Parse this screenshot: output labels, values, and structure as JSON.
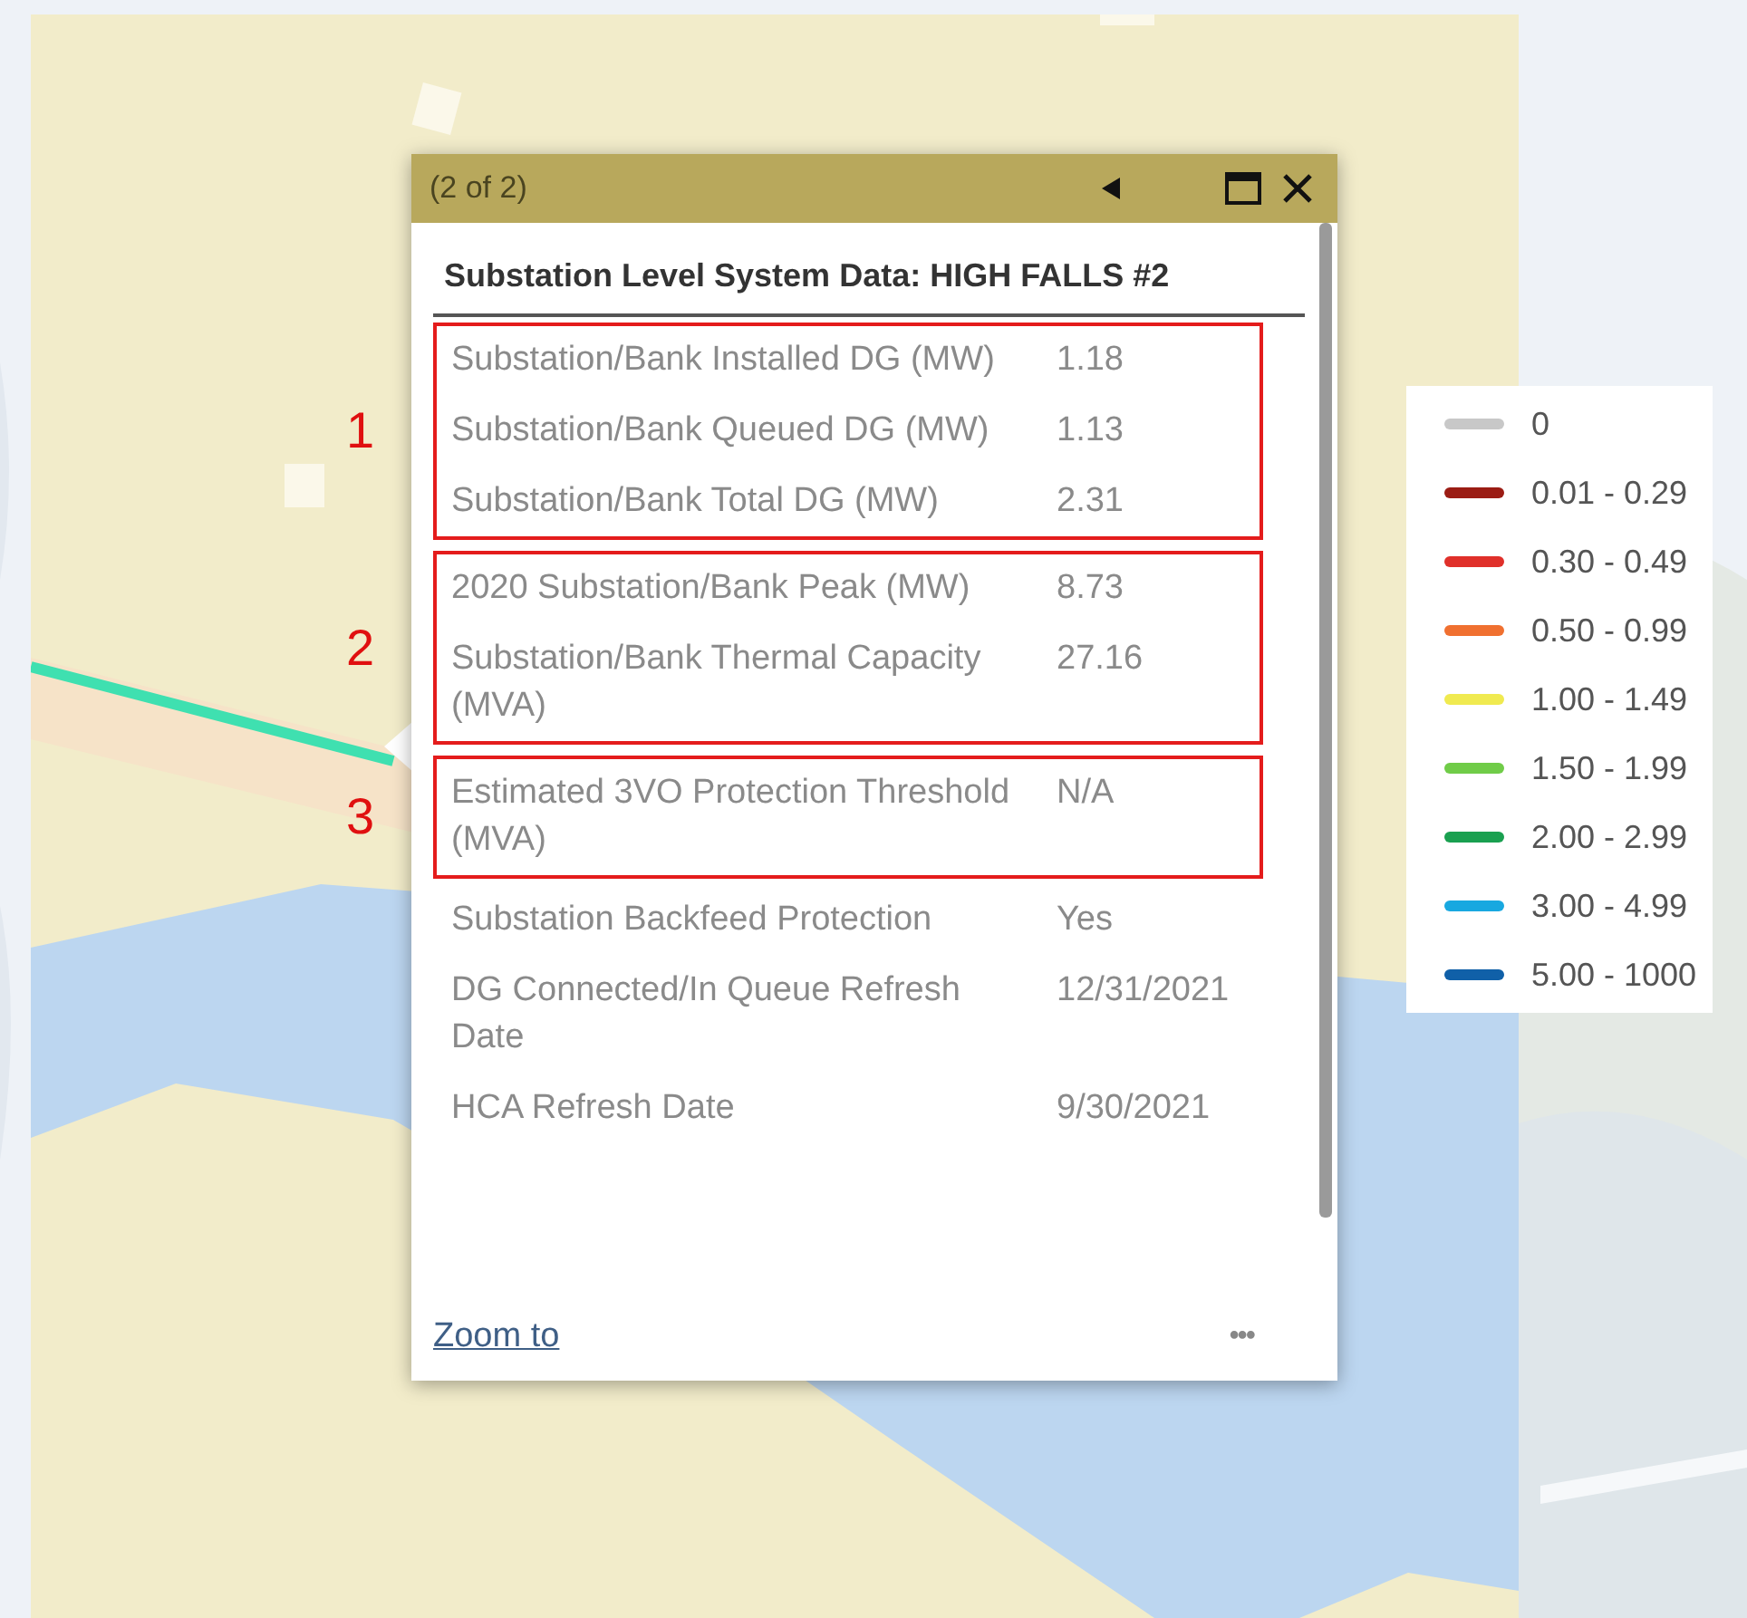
{
  "popup": {
    "counter": "(2 of 2)",
    "title": "Substation Level System Data: HIGH FALLS #2",
    "sections": [
      {
        "kind": "marked",
        "marker": "1",
        "rows": [
          {
            "label": "Substation/Bank Installed DG (MW)",
            "value": "1.18"
          },
          {
            "label": "Substation/Bank Queued DG (MW)",
            "value": "1.13"
          },
          {
            "label": "Substation/Bank Total DG (MW)",
            "value": "2.31"
          }
        ]
      },
      {
        "kind": "marked",
        "marker": "2",
        "rows": [
          {
            "label": "2020 Substation/Bank Peak (MW)",
            "value": "8.73"
          },
          {
            "label": "Substation/Bank Thermal Capacity (MVA)",
            "value": "27.16"
          }
        ]
      },
      {
        "kind": "marked",
        "marker": "3",
        "rows": [
          {
            "label": "Estimated 3VO Protection Threshold (MVA)",
            "value": "N/A"
          }
        ]
      },
      {
        "kind": "plain",
        "rows": [
          {
            "label": "Substation Backfeed Protection",
            "value": "Yes"
          },
          {
            "label": "DG Connected/In Queue Refresh Date",
            "value": "12/31/2021"
          },
          {
            "label": "HCA Refresh Date",
            "value": "9/30/2021"
          }
        ]
      }
    ],
    "zoom_link": "Zoom to",
    "more": "•••"
  },
  "legend": [
    {
      "label": "0",
      "color": "#c8c8c8"
    },
    {
      "label": "0.01 - 0.29",
      "color": "#9b1c14"
    },
    {
      "label": "0.30 - 0.49",
      "color": "#e0302a"
    },
    {
      "label": "0.50 - 0.99",
      "color": "#f07030"
    },
    {
      "label": "1.00 - 1.49",
      "color": "#f0ea50"
    },
    {
      "label": "1.50 - 1.99",
      "color": "#70cc48"
    },
    {
      "label": "2.00 - 2.99",
      "color": "#1aa050"
    },
    {
      "label": "3.00 - 4.99",
      "color": "#18a8e0"
    },
    {
      "label": "5.00 - 1000",
      "color": "#1060a8"
    }
  ]
}
